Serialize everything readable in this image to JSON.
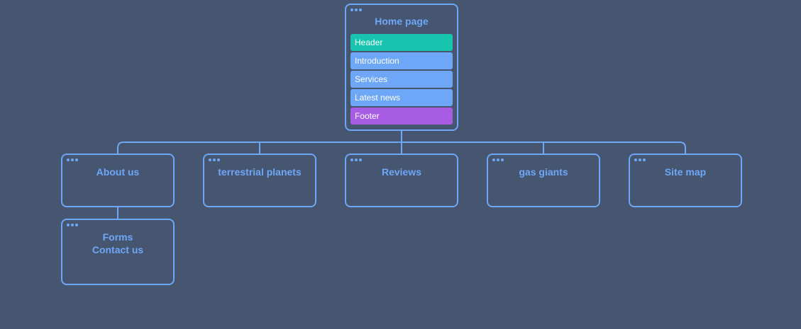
{
  "colors": {
    "background": "#465671",
    "node_border": "#6ea7f7",
    "section_default": "#6ea7f7",
    "section_header": "#17c4ae",
    "section_footer": "#a75ce3"
  },
  "home": {
    "title": "Home page",
    "sections": [
      {
        "label": "Header",
        "color": "#17c4ae"
      },
      {
        "label": "Introduction",
        "color": "#6ea7f7"
      },
      {
        "label": "Services",
        "color": "#6ea7f7"
      },
      {
        "label": "Latest news",
        "color": "#6ea7f7"
      },
      {
        "label": "Footer",
        "color": "#a75ce3"
      }
    ]
  },
  "children": [
    {
      "title": "About us"
    },
    {
      "title": "terrestrial planets"
    },
    {
      "title": "Reviews"
    },
    {
      "title": "gas giants"
    },
    {
      "title": "Site map"
    }
  ],
  "grandchild": {
    "line1": "Forms",
    "line2": "Contact us"
  }
}
